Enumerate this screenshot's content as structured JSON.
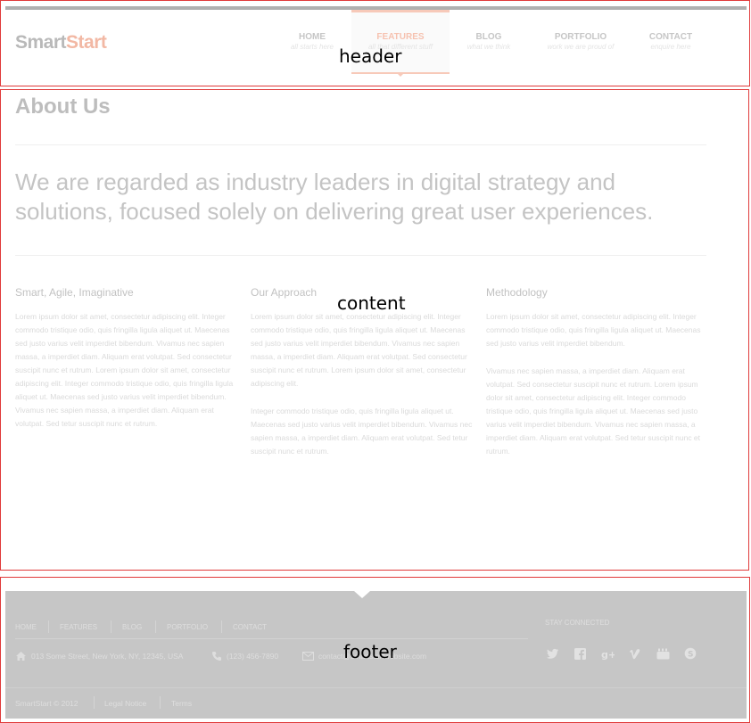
{
  "header": {
    "logo": {
      "part1": "SmartStart",
      "smart": "Smart",
      "start": "Start"
    },
    "nav": [
      {
        "label": "HOME",
        "sub": "all starts here"
      },
      {
        "label": "FEATURES",
        "sub": "all that different stuff",
        "active": true
      },
      {
        "label": "BLOG",
        "sub": "what we think"
      },
      {
        "label": "PORTFOLIO",
        "sub": "work we are proud of"
      },
      {
        "label": "CONTACT",
        "sub": "enquire here"
      }
    ]
  },
  "content": {
    "title": "About Us",
    "lead": "We are regarded as industry leaders in digital strategy and solutions, focused solely on delivering great user experiences.",
    "columns": [
      {
        "heading": "Smart, Agile, Imaginative",
        "paragraphs": [
          "Lorem ipsum dolor sit amet, consectetur adipiscing elit. Integer commodo tristique odio, quis fringilla ligula aliquet ut. Maecenas sed justo varius velit imperdiet bibendum. Vivamus nec sapien massa, a imperdiet diam. Aliquam erat volutpat. Sed consectetur suscipit nunc et rutrum. Lorem ipsum dolor sit amet, consectetur adipiscing elit. Integer commodo tristique odio, quis fringilla ligula aliquet ut. Maecenas sed justo varius velit imperdiet bibendum. Vivamus nec sapien massa, a imperdiet diam. Aliquam erat volutpat. Sed tetur suscipit nunc et rutrum."
        ]
      },
      {
        "heading": "Our Approach",
        "paragraphs": [
          "Lorem ipsum dolor sit amet, consectetur adipiscing elit. Integer commodo tristique odio, quis fringilla ligula aliquet ut. Maecenas sed justo varius velit imperdiet bibendum. Vivamus nec sapien massa, a imperdiet diam. Aliquam erat volutpat. Sed consectetur suscipit nunc et rutrum. Lorem ipsum dolor sit amet, consectetur adipiscing elit.",
          "Integer commodo tristique odio, quis fringilla ligula aliquet ut. Maecenas sed justo varius velit imperdiet bibendum. Vivamus nec sapien massa, a imperdiet diam. Aliquam erat volutpat. Sed tetur suscipit nunc et rutrum."
        ]
      },
      {
        "heading": "Methodology",
        "paragraphs": [
          "Lorem ipsum dolor sit amet, consectetur adipiscing elit. Integer commodo tristique odio, quis fringilla ligula aliquet ut. Maecenas sed justo varius velit imperdiet bibendum.",
          "Vivamus nec sapien massa, a imperdiet diam. Aliquam erat volutpat. Sed consectetur suscipit nunc et rutrum. Lorem ipsum dolor sit amet, consectetur adipiscing elit. Integer commodo tristique odio, quis fringilla ligula aliquet ut. Maecenas sed justo varius velit imperdiet bibendum. Vivamus nec sapien massa, a imperdiet diam. Aliquam erat volutpat. Sed tetur suscipit nunc et rutrum."
        ]
      }
    ]
  },
  "footer": {
    "nav": [
      "HOME",
      "FEATURES",
      "BLOG",
      "PORTFOLIO",
      "CONTACT"
    ],
    "stay_connected": "STAY CONNECTED",
    "address": "013 Some Street, New York, NY, 12345, USA",
    "phone": "(123) 456-7890",
    "email": "contact@smartstartwebsite.com",
    "copyright": "SmartStart © 2012",
    "legal": "Legal Notice",
    "terms": "Terms",
    "social_icons": [
      "twitter-icon",
      "facebook-icon",
      "google-plus-icon",
      "vimeo-icon",
      "youtube-icon",
      "skype-icon"
    ]
  },
  "annotations": {
    "header": "header",
    "content": "content",
    "footer": "footer"
  },
  "colors": {
    "accent": "#f7c9b9",
    "footer_bg": "#c6c6c6",
    "region_outline": "#e03a3a"
  }
}
